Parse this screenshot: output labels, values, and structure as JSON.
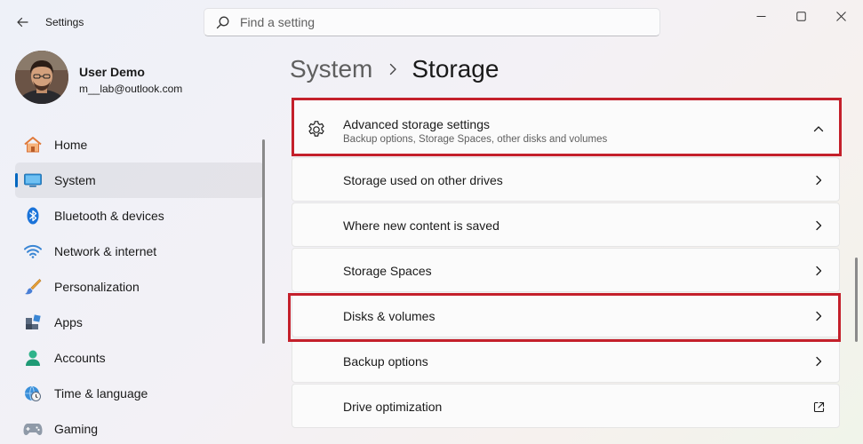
{
  "window": {
    "title": "Settings"
  },
  "search": {
    "placeholder": "Find a setting"
  },
  "user": {
    "name": "User Demo",
    "email": "m__lab@outlook.com"
  },
  "nav": {
    "items": [
      {
        "label": "Home",
        "icon": "home-icon"
      },
      {
        "label": "System",
        "icon": "system-icon",
        "selected": true
      },
      {
        "label": "Bluetooth & devices",
        "icon": "bluetooth-icon"
      },
      {
        "label": "Network & internet",
        "icon": "wifi-icon"
      },
      {
        "label": "Personalization",
        "icon": "brush-icon"
      },
      {
        "label": "Apps",
        "icon": "apps-icon"
      },
      {
        "label": "Accounts",
        "icon": "accounts-icon"
      },
      {
        "label": "Time & language",
        "icon": "globe-clock-icon"
      },
      {
        "label": "Gaming",
        "icon": "gamepad-icon"
      }
    ]
  },
  "breadcrumb": {
    "parent": "System",
    "current": "Storage"
  },
  "advanced": {
    "title": "Advanced storage settings",
    "description": "Backup options, Storage Spaces, other disks and volumes",
    "expanded": true,
    "items": [
      {
        "label": "Storage used on other drives",
        "icon": "chevron-right-icon"
      },
      {
        "label": "Where new content is saved",
        "icon": "chevron-right-icon"
      },
      {
        "label": "Storage Spaces",
        "icon": "chevron-right-icon"
      },
      {
        "label": "Disks & volumes",
        "icon": "chevron-right-icon",
        "highlighted": true
      },
      {
        "label": "Backup options",
        "icon": "chevron-right-icon"
      },
      {
        "label": "Drive optimization",
        "icon": "external-link-icon"
      }
    ]
  },
  "colors": {
    "accent": "#0067c0",
    "highlight": "#c4202b"
  }
}
